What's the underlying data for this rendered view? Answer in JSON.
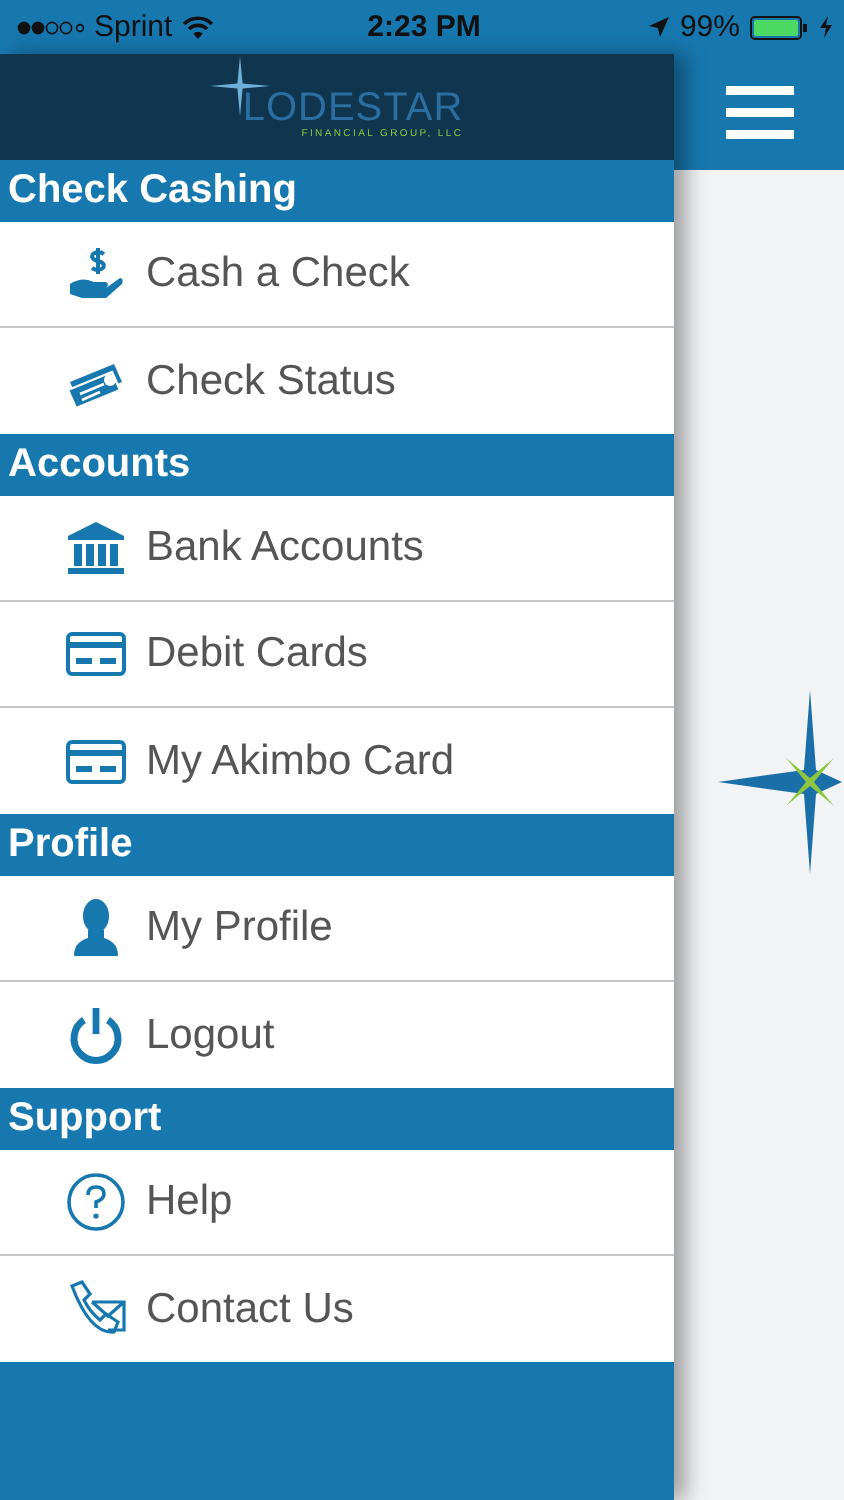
{
  "status_bar": {
    "carrier": "Sprint",
    "time": "2:23 PM",
    "battery": "99%"
  },
  "drawer": {
    "logo": {
      "name": "LODESTAR",
      "tagline": "FINANCIAL GROUP, LLC"
    },
    "sections": [
      {
        "title": "Check Cashing",
        "items": [
          {
            "label": "Cash a Check"
          },
          {
            "label": "Check Status"
          }
        ]
      },
      {
        "title": "Accounts",
        "items": [
          {
            "label": "Bank Accounts"
          },
          {
            "label": "Debit Cards"
          },
          {
            "label": "My Akimbo Card"
          }
        ]
      },
      {
        "title": "Profile",
        "items": [
          {
            "label": "My Profile"
          },
          {
            "label": "Logout"
          }
        ]
      },
      {
        "title": "Support",
        "items": [
          {
            "label": "Help"
          },
          {
            "label": "Contact Us"
          }
        ]
      }
    ]
  }
}
